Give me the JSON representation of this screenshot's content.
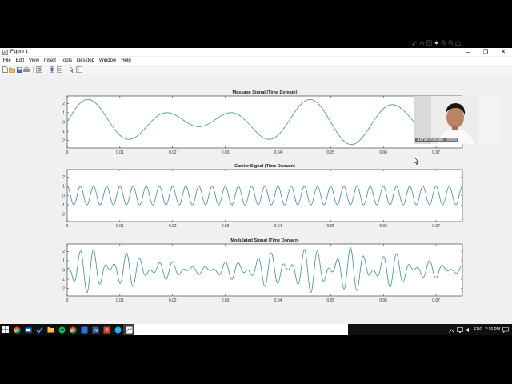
{
  "window": {
    "title": "Figure 1",
    "minimize_glyph": "—",
    "maximize_glyph": "❐",
    "close_glyph": "✕"
  },
  "menubar": {
    "items": [
      "File",
      "Edit",
      "View",
      "Insert",
      "Tools",
      "Desktop",
      "Window",
      "Help"
    ]
  },
  "toolbar": {
    "icons": [
      "new-figure-icon",
      "open-file-icon",
      "save-icon",
      "print-icon",
      "print-preview-icon",
      "link-plot-icon",
      "insert-colorbar-icon",
      "insert-legend-icon",
      "pointer-icon",
      "plot-tools-icon"
    ]
  },
  "axes_toolbar": {
    "icons": [
      "brush-icon",
      "data-tips-icon",
      "export-icon",
      "pan-icon",
      "zoom-in-icon",
      "zoom-out-icon",
      "home-icon"
    ]
  },
  "webcam": {
    "name_label": "Abhrel Mikael Torres"
  },
  "taskbar": {
    "apps": [
      "start-icon",
      "search-icon",
      "chrome-icon",
      "task-view-icon",
      "todo-icon",
      "file-explorer-icon",
      "spotify-icon",
      "chrome-icon-2",
      "app-icon",
      "word-icon",
      "powerpoint-icon",
      "edge-icon",
      "matlab-figure-icon"
    ],
    "language": "ENG",
    "time": "7:16 PM"
  },
  "chart_data": [
    {
      "type": "line",
      "title": "Message Signal (Time Domain)",
      "xlabel": "",
      "ylabel": "",
      "xlim": [
        0,
        0.075
      ],
      "ylim": [
        -2.8,
        2.8
      ],
      "xticks": [
        "0",
        "0.01",
        "0.02",
        "0.03",
        "0.04",
        "0.05",
        "0.06",
        "0.07"
      ],
      "yticks": [
        "2",
        "1",
        "0",
        "-1",
        "-2"
      ],
      "series": [
        {
          "function": "sin(2*pi*50*t) + 1.5*sin(2*pi*70*t)",
          "color": "#3a8e9a"
        }
      ]
    },
    {
      "type": "line",
      "title": "Carrier Signal (Time Domain)",
      "xlabel": "",
      "ylabel": "",
      "xlim": [
        0,
        0.075
      ],
      "ylim": [
        -2.8,
        2.8
      ],
      "xticks": [
        "0",
        "0.01",
        "0.02",
        "0.03",
        "0.04",
        "0.05",
        "0.06",
        "0.07"
      ],
      "yticks": [
        "2",
        "1",
        "0",
        "-1",
        "-2"
      ],
      "series": [
        {
          "function": "cos(2*pi*400*t)",
          "color": "#3a8e9a"
        }
      ]
    },
    {
      "type": "line",
      "title": "Modulated Signal (Time Domain)",
      "xlabel": "",
      "ylabel": "",
      "xlim": [
        0,
        0.075
      ],
      "ylim": [
        -2.8,
        2.8
      ],
      "xticks": [
        "0",
        "0.01",
        "0.02",
        "0.03",
        "0.04",
        "0.05",
        "0.06",
        "0.07"
      ],
      "yticks": [
        "2",
        "1",
        "0",
        "-1",
        "-2"
      ],
      "series": [
        {
          "function": "message(t) * carrier(t)",
          "color": "#3a8e9a"
        }
      ]
    }
  ]
}
